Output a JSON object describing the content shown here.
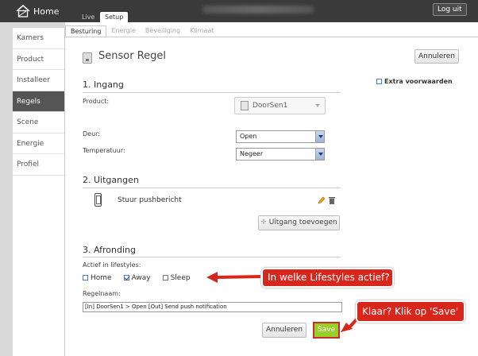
{
  "topbar": {
    "brand": "Home",
    "tabs": [
      {
        "label": "Live"
      },
      {
        "label": "Setup"
      }
    ],
    "logout_label": "Log uit"
  },
  "sidebar": {
    "items": [
      {
        "label": "Kamers"
      },
      {
        "label": "Product"
      },
      {
        "label": "Installeer"
      },
      {
        "label": "Regels"
      },
      {
        "label": "Scene"
      },
      {
        "label": "Energie"
      },
      {
        "label": "Profiel"
      }
    ],
    "active": "Regels"
  },
  "subtabs": [
    {
      "label": "Besturing"
    },
    {
      "label": "Energie"
    },
    {
      "label": "Beveiliging"
    },
    {
      "label": "Klimaat"
    }
  ],
  "header": {
    "icon": "sensor-icon",
    "title": "Sensor Regel",
    "cancel_label": "Annuleren"
  },
  "extra": {
    "label": "Extra voorwaarden"
  },
  "input_section": {
    "title": "1. Ingang",
    "product_label": "Product:",
    "product_value": "DoorSen1",
    "door_label": "Deur:",
    "door_value": "Open",
    "temp_label": "Temperatuur:",
    "temp_value": "Negeer"
  },
  "output_section": {
    "title": "2. Uitgangen",
    "output_label": "Stuur pushbericht",
    "add_label": "Uitgang toevoegen"
  },
  "finish_section": {
    "title": "3. Afronding",
    "lifestyles_label": "Actief in lifestyles:",
    "lifestyles": [
      {
        "label": "Home",
        "checked": false
      },
      {
        "label": "Away",
        "checked": true
      },
      {
        "label": "Sleep",
        "checked": false
      }
    ],
    "rule_name_label": "Regelnaam:",
    "rule_name_value": "[In] DoorSen1 > Open  [Out] Send push notification",
    "cancel_label": "Annuleren",
    "save_label": "Save"
  },
  "callouts": {
    "lifestyles": "In welke Lifestyles actief?",
    "save": "Klaar? Klik op 'Save'"
  },
  "colors": {
    "topbar": "#3a3a3a",
    "sidebar_active": "#555555",
    "save_green": "#98cf28",
    "callout_red": "#d9261c"
  }
}
